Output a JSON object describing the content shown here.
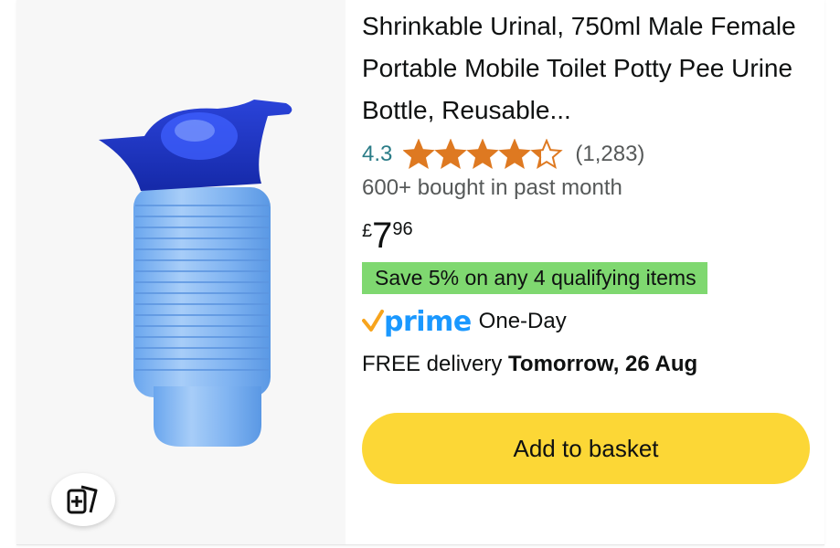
{
  "product": {
    "title": "Shrinkable Urinal, 750ml Male Female Portable Mobile Toilet Potty Pee Urine Bottle, Reusable...",
    "rating": "4.3",
    "rating_value": 4.3,
    "review_count": "(1,283)",
    "bought": "600+ bought in past month",
    "price": {
      "symbol": "£",
      "whole": "7",
      "fraction": "96"
    },
    "promo": "Save 5% on any 4 qualifying items",
    "prime": {
      "logo_text": "prime",
      "label": "One-Day"
    },
    "delivery": {
      "prefix": "FREE delivery ",
      "date": "Tomorrow, 26 Aug"
    },
    "add_to_basket": "Add to basket"
  },
  "colors": {
    "star": "#de7921",
    "rating_text": "#2a7c87",
    "promo_bg": "#7fd870",
    "prime_blue": "#1a98ff",
    "prime_check": "#f7a41d",
    "button_bg": "#fcd736"
  },
  "icons": {
    "compare": "compare-cards-icon"
  }
}
